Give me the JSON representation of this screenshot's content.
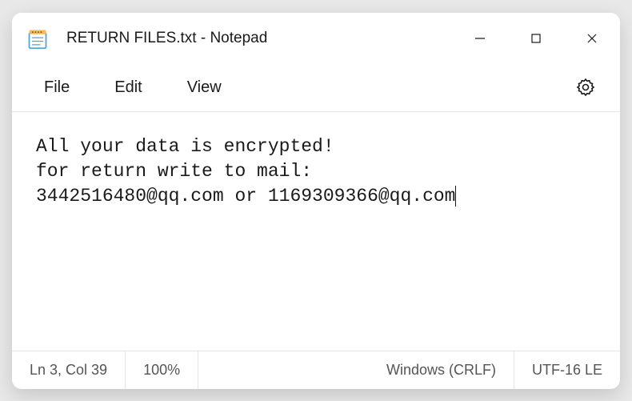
{
  "titlebar": {
    "title": "RETURN FILES.txt - Notepad"
  },
  "menu": {
    "file": "File",
    "edit": "Edit",
    "view": "View"
  },
  "content": {
    "line1": "All your data is encrypted!",
    "line2": "for return write to mail:",
    "line3": "3442516480@qq.com or 1169309366@qq.com"
  },
  "statusbar": {
    "position": "Ln 3, Col 39",
    "zoom": "100%",
    "lineending": "Windows (CRLF)",
    "encoding": "UTF-16 LE"
  }
}
